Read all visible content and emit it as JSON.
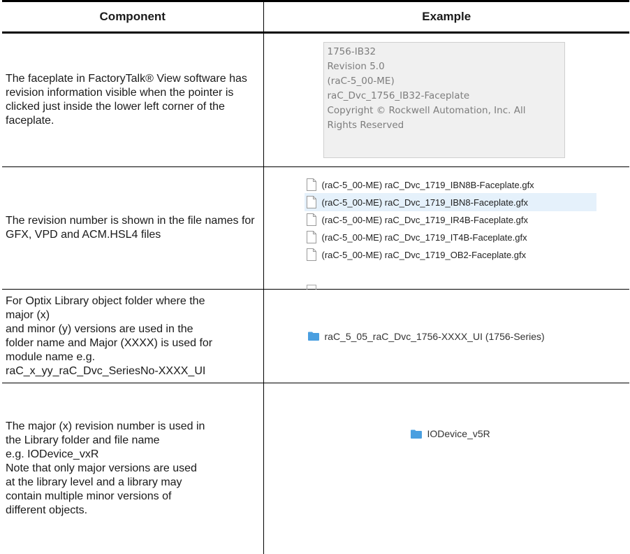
{
  "headers": {
    "component": "Component",
    "example": "Example"
  },
  "rows": [
    {
      "component": "The faceplate in FactoryTalk® View software has revision information visible when the pointer is clicked just inside the lower left corner of the faceplate.",
      "tooltip_lines": [
        "1756-IB32",
        "Revision 5.0",
        "(raC-5_00-ME)",
        "raC_Dvc_1756_IB32-Faceplate",
        "Copyright © Rockwell Automation, Inc.  All",
        "Rights Reserved"
      ]
    },
    {
      "component": "The revision number is shown in the file names for GFX, VPD and ACM.HSL4 files",
      "files": [
        {
          "name": "(raC-5_00-ME) raC_Dvc_1719_IBN8B-Faceplate.gfx",
          "selected": false
        },
        {
          "name": "(raC-5_00-ME) raC_Dvc_1719_IBN8-Faceplate.gfx",
          "selected": true
        },
        {
          "name": "(raC-5_00-ME) raC_Dvc_1719_IR4B-Faceplate.gfx",
          "selected": false
        },
        {
          "name": "(raC-5_00-ME) raC_Dvc_1719_IT4B-Faceplate.gfx",
          "selected": false
        },
        {
          "name": "(raC-5_00-ME) raC_Dvc_1719_OB2-Faceplate.gfx",
          "selected": false
        }
      ],
      "file_icon": "document-icon"
    },
    {
      "component_lines": [
        "For Optix Library object folder where the",
        "major (x)",
        "and minor (y) versions are used in the",
        "folder name and Major (XXXX) is used for",
        "module name e.g.",
        "raC_x_yy_raC_Dvc_SeriesNo-XXXX_UI"
      ],
      "folder_name": "raC_5_05_raC_Dvc_1756-XXXX_UI (1756-Series)",
      "folder_icon": "folder-icon"
    },
    {
      "component_lines": [
        "The major (x) revision number is used in",
        "the Library folder and file name",
        "e.g. IODevice_vxR",
        "Note that only major versions are used",
        "at the library level and a library may",
        "contain multiple minor versions of",
        "different objects."
      ],
      "folder_name": "IODevice_v5R",
      "folder_icon": "folder-icon"
    }
  ],
  "colors": {
    "folder": "#4a9fe0",
    "selection": "#e5f1fb",
    "tooltip_bg": "#f0f0f0"
  }
}
